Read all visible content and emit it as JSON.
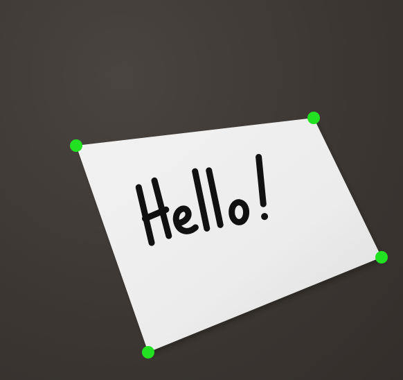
{
  "photo": {
    "background_color": "#3e3935",
    "paper_color": "#eeeeee",
    "ink_color": "#111111",
    "marker_color": "#22e022",
    "handwritten_text": "Hello!"
  },
  "corner_markers": [
    {
      "name": "top-left"
    },
    {
      "name": "top-right"
    },
    {
      "name": "bottom-right"
    },
    {
      "name": "bottom-left"
    }
  ]
}
